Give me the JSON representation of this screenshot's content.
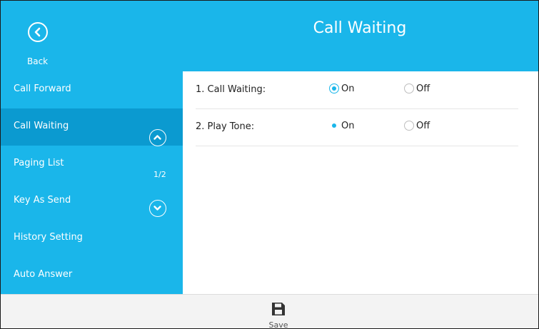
{
  "header": {
    "title": "Call Waiting",
    "back_label": "Back"
  },
  "sidebar": {
    "items": [
      {
        "label": "Call Forward",
        "active": false
      },
      {
        "label": "Call Waiting",
        "active": true
      },
      {
        "label": "Paging List",
        "active": false
      },
      {
        "label": "Key As Send",
        "active": false
      },
      {
        "label": "History Setting",
        "active": false
      },
      {
        "label": "Auto Answer",
        "active": false
      }
    ],
    "page_indicator": "1/2"
  },
  "settings": [
    {
      "label": "1. Call Waiting:",
      "on_label": "On",
      "off_label": "Off",
      "selected": "On"
    },
    {
      "label": "2. Play Tone:",
      "on_label": "On",
      "off_label": "Off",
      "selected": "On"
    }
  ],
  "footer": {
    "save_label": "Save"
  },
  "colors": {
    "accent": "#1ab6ea",
    "active_item": "#0b9ad0",
    "footer_bg": "#f3f3f3"
  },
  "icons": {
    "back": "back-arrow-circle-icon",
    "up": "chevron-up-circle-icon",
    "down": "chevron-down-circle-icon",
    "save": "floppy-disk-icon"
  }
}
